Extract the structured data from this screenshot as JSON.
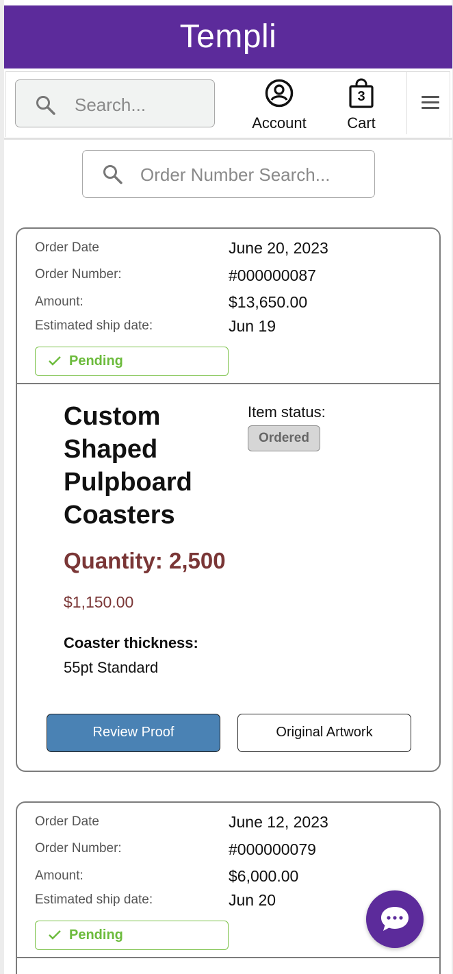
{
  "brand": {
    "name": "Templi",
    "color": "#5c2b9b"
  },
  "header": {
    "search_placeholder": "Search...",
    "account_label": "Account",
    "cart_label": "Cart",
    "cart_count": "3",
    "icons": [
      "search-icon",
      "account-icon",
      "shopping-bag-icon",
      "menu-icon"
    ]
  },
  "order_search": {
    "placeholder": "Order Number Search..."
  },
  "labels": {
    "order_date": "Order Date",
    "order_number": "Order Number:",
    "amount": "Amount:",
    "ship_date": "Estimated ship date:",
    "item_status": "Item status:"
  },
  "orders": [
    {
      "date": "June 20, 2023",
      "number": "#000000087",
      "amount": "$13,650.00",
      "ship_date": "Jun 19",
      "status": "Pending",
      "item": {
        "title": "Custom Shaped Pulpboard Coasters",
        "status": "Ordered",
        "quantity": "Quantity: 2,500",
        "price": "$1,150.00",
        "option_label": "Coaster thickness:",
        "option_value": "55pt Standard",
        "review_button": "Review Proof",
        "artwork_button": "Original Artwork"
      }
    },
    {
      "date": "June 12, 2023",
      "number": "#000000079",
      "amount": "$6,000.00",
      "ship_date": "Jun 20",
      "status": "Pending"
    }
  ],
  "colors": {
    "status_pending": "#6cbb3c",
    "primary_button": "#4a82b4",
    "quantity_text": "#7a3636"
  }
}
